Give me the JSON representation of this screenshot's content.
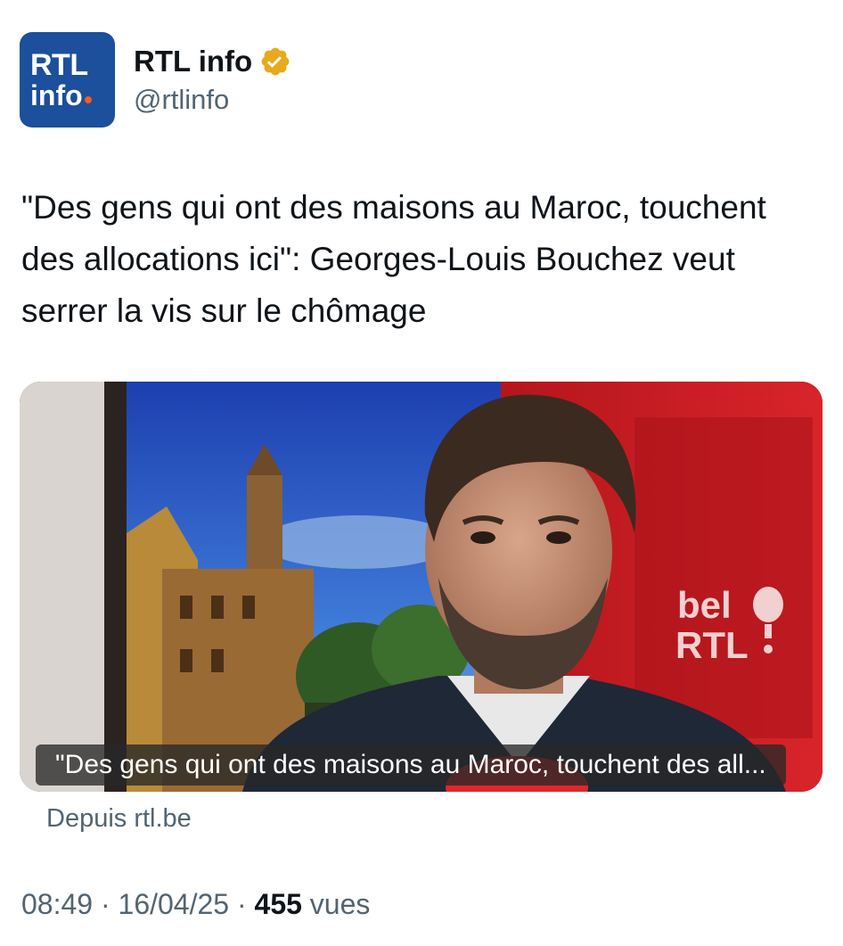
{
  "account": {
    "avatar_line1": "RTL",
    "avatar_line2": "info",
    "display_name": "RTL info",
    "handle": "@rtlinfo",
    "verified_icon": "verified-badge-gold",
    "brand_color": "#1c4f9c",
    "badge_color": "#e8a91d"
  },
  "tweet": {
    "text": "\"Des gens qui ont des maisons au Maroc, touchent des allocations ici\": Georges-Louis Bouchez veut serrer la vis sur le chômage"
  },
  "media": {
    "caption": "\"Des gens qui ont des maisons au Maroc, touchent des all...",
    "logo_line1": "bel",
    "logo_line2": "RTL",
    "source_label": "Depuis rtl.be"
  },
  "meta": {
    "time": "08:49",
    "sep1": " · ",
    "date": "16/04/25",
    "sep2": " · ",
    "views_count": "455",
    "views_label": " vues"
  }
}
